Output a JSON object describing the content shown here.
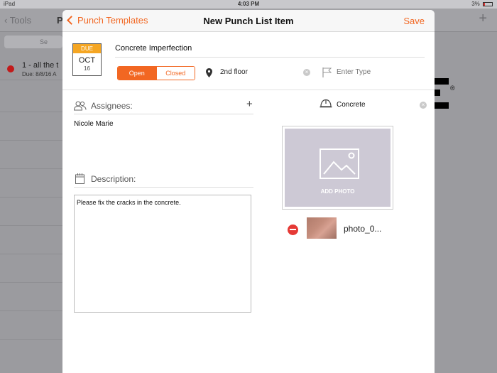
{
  "status_bar": {
    "device": "iPad",
    "time": "4:03 PM",
    "battery": "3%"
  },
  "background": {
    "back_label": "Tools",
    "title_fragment": "P",
    "search_fragment": "Se",
    "list_item": {
      "title": "1 - all the t",
      "due": "Due: 8/8/16 A"
    }
  },
  "nav": {
    "back_label": "Punch Templates",
    "title": "New Punch List Item",
    "save_label": "Save"
  },
  "due": {
    "label": "DUE",
    "month": "OCT",
    "day": "16"
  },
  "item": {
    "title": "Concrete Imperfection"
  },
  "status": {
    "open_label": "Open",
    "closed_label": "Closed",
    "selected": "Open"
  },
  "location": {
    "value": "2nd floor"
  },
  "type": {
    "placeholder": "Enter Type"
  },
  "assignees": {
    "label": "Assignees:",
    "names": [
      "Nicole Marie"
    ]
  },
  "description": {
    "label": "Description:",
    "text": "Please fix the cracks in the concrete."
  },
  "trade": {
    "value": "Concrete"
  },
  "photo": {
    "add_label": "ADD PHOTO",
    "attachments": [
      {
        "name": "photo_0..."
      }
    ]
  },
  "colors": {
    "accent": "#f26722",
    "due_header": "#f5a623",
    "delete": "#e53935",
    "photo_placeholder": "#cdc9d5"
  },
  "icons": [
    "location-pin-icon",
    "clear-icon",
    "flag-icon",
    "assignees-icon",
    "add-icon",
    "calendar-icon",
    "hard-hat-icon",
    "image-icon",
    "remove-icon"
  ]
}
